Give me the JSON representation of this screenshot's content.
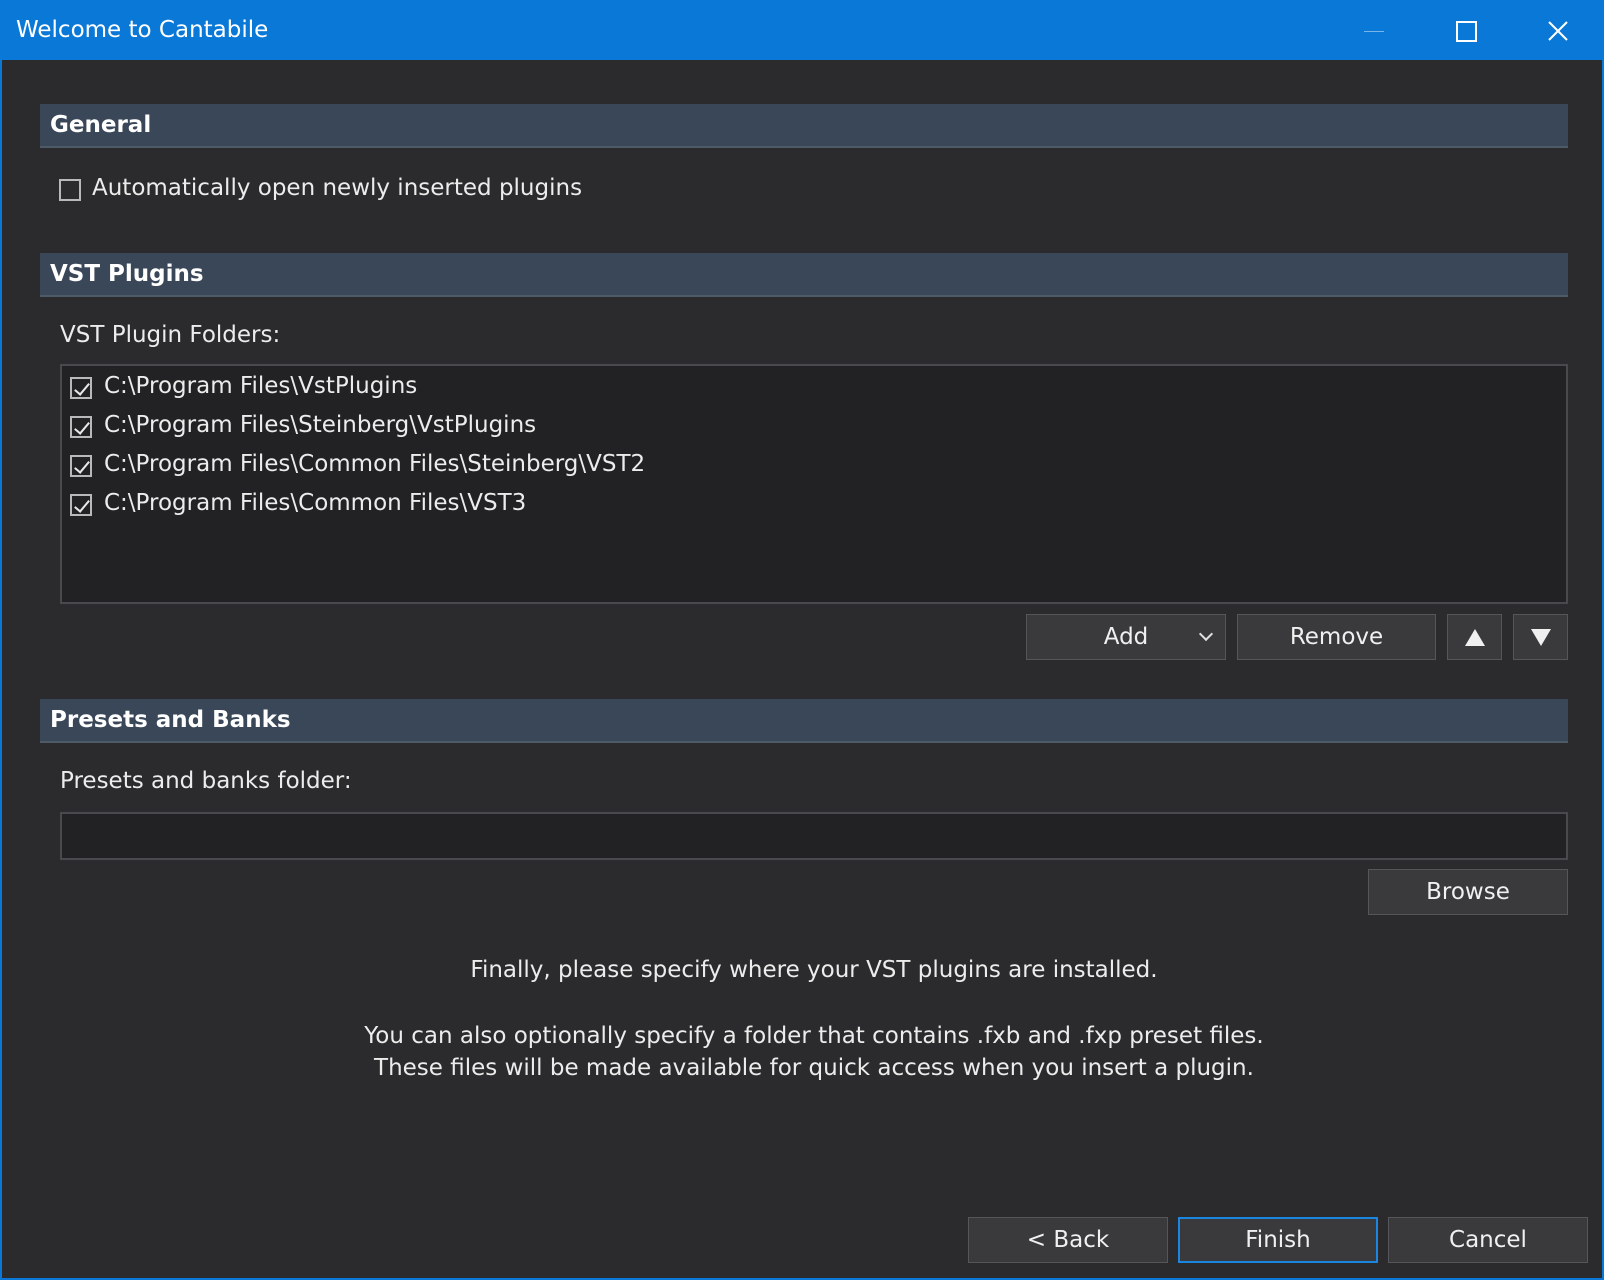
{
  "window": {
    "title": "Welcome to Cantabile",
    "accent_color": "#0a78d7"
  },
  "general": {
    "header": "General",
    "auto_open_label": "Automatically open newly inserted plugins",
    "auto_open_checked": false
  },
  "vst": {
    "header": "VST Plugins",
    "folders_label": "VST Plugin Folders:",
    "folders": [
      {
        "path": "C:\\Program Files\\VstPlugins",
        "checked": true
      },
      {
        "path": "C:\\Program Files\\Steinberg\\VstPlugins",
        "checked": true
      },
      {
        "path": "C:\\Program Files\\Common Files\\Steinberg\\VST2",
        "checked": true
      },
      {
        "path": "C:\\Program Files\\Common Files\\VST3",
        "checked": true
      }
    ],
    "add_label": "Add",
    "remove_label": "Remove"
  },
  "presets": {
    "header": "Presets and Banks",
    "folder_label": "Presets and banks folder:",
    "folder_value": "",
    "browse_label": "Browse"
  },
  "info": {
    "line1": "Finally, please specify where your VST plugins are installed.",
    "line2": "You can also optionally specify a folder that contains .fxb and .fxp preset files.",
    "line3": "These files will be made available for quick access when you insert a plugin."
  },
  "footer": {
    "back_label": "< Back",
    "finish_label": "Finish",
    "cancel_label": "Cancel"
  }
}
